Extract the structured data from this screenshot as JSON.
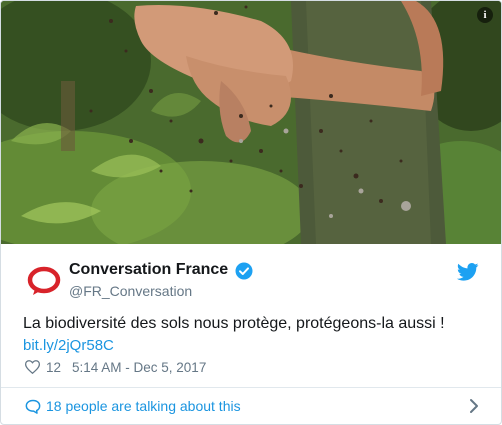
{
  "photo": {
    "description_icon": "info-icon",
    "info_label": "i"
  },
  "account": {
    "name": "Conversation France",
    "handle": "@FR_Conversation",
    "logo_icon": "conversation-logo-icon",
    "verified_icon": "verified-badge-icon"
  },
  "tweet": {
    "text": "La biodiversité des sols nous protège, protégeons-la aussi !",
    "link": "bit.ly/2jQr58C",
    "likes": "12",
    "timestamp": "5:14 AM - Dec 5, 2017"
  },
  "footer": {
    "talking": "18 people are talking about this"
  },
  "colors": {
    "link": "#1b95e0",
    "text": "#14171a",
    "muted": "#657786",
    "brand_red": "#d8232a",
    "verified": "#1da1f2"
  }
}
